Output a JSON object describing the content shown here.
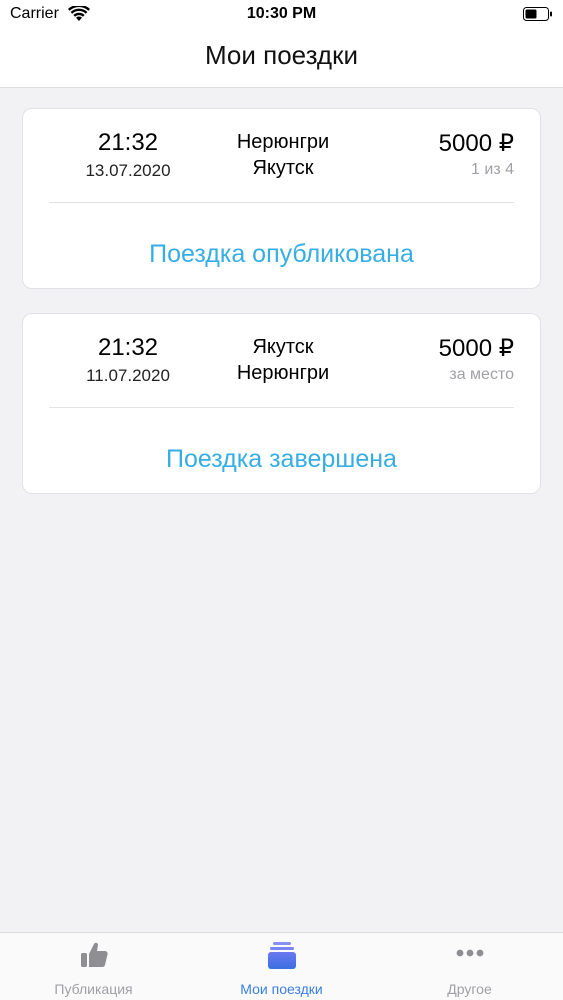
{
  "status_bar": {
    "carrier": "Carrier",
    "time": "10:30 PM",
    "wifi_icon": "wifi-icon",
    "battery_icon": "battery-icon"
  },
  "nav": {
    "title": "Мои поездки"
  },
  "trips": [
    {
      "time": "21:32",
      "date": "13.07.2020",
      "from": "Нерюнгри",
      "to": "Якутск",
      "price": "5000 ₽",
      "sub": "1 из 4",
      "status": "Поездка опубликована"
    },
    {
      "time": "21:32",
      "date": "11.07.2020",
      "from": "Якутск",
      "to": "Нерюнгри",
      "price": "5000 ₽",
      "sub": "за место",
      "status": "Поездка завершена"
    }
  ],
  "tabs": [
    {
      "label": "Публикация",
      "icon": "thumbs-up-icon",
      "active": false
    },
    {
      "label": "Мои поездки",
      "icon": "stack-icon",
      "active": true
    },
    {
      "label": "Другое",
      "icon": "more-dots-icon",
      "active": false
    }
  ],
  "colors": {
    "accent": "#36aee3",
    "tab_active": "#3a7fe0",
    "tab_inactive": "#a0a0a6",
    "background": "#f2f2f4"
  }
}
